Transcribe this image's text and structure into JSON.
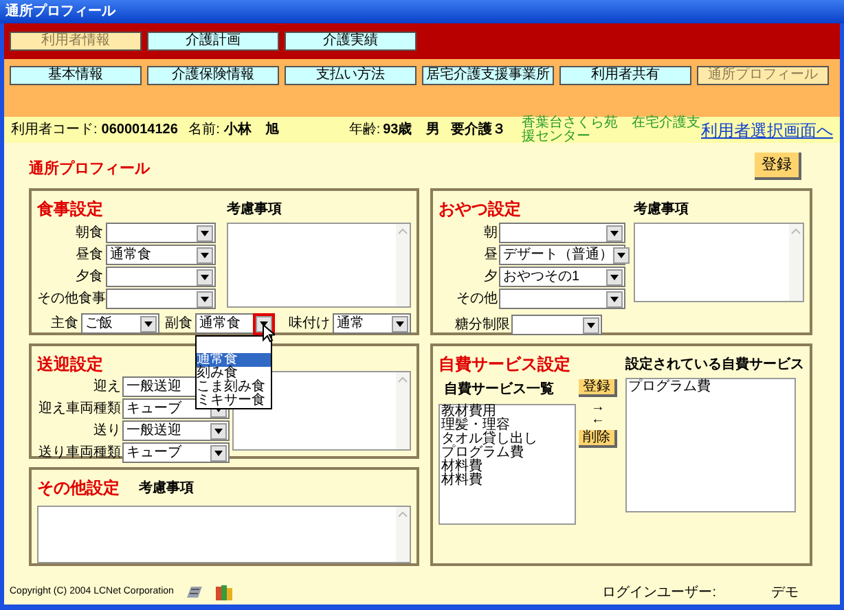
{
  "window": {
    "title": "通所プロフィール"
  },
  "main_tabs": [
    {
      "label": "利用者情報",
      "selected": true
    },
    {
      "label": "介護計画",
      "selected": false
    },
    {
      "label": "介護実績",
      "selected": false
    }
  ],
  "sub_tabs": [
    {
      "label": "基本情報",
      "selected": false
    },
    {
      "label": "介護保険情報",
      "selected": false
    },
    {
      "label": "支払い方法",
      "selected": false
    },
    {
      "label": "居宅介護支援事業所",
      "selected": false
    },
    {
      "label": "利用者共有",
      "selected": false
    },
    {
      "label": "通所プロフィール",
      "selected": true
    }
  ],
  "user_info": {
    "code_label": "利用者コード:",
    "code": "0600014126",
    "name_label": "名前:",
    "name": "小林　旭",
    "age_label": "年齢:",
    "age": "93歳",
    "sex": "男",
    "care_level": "要介護３",
    "office": "香葉台さくら苑　在宅介護支援センター",
    "link": "利用者選択画面へ"
  },
  "page_title": "通所プロフィール",
  "save_button": "登録",
  "meal": {
    "title": "食事設定",
    "notes_label": "考慮事項",
    "fields": [
      {
        "label": "朝食"
      },
      {
        "label": "昼食",
        "value": "通常食"
      },
      {
        "label": "夕食"
      },
      {
        "label": "その他食事"
      }
    ],
    "main_dish": {
      "label": "主食",
      "value": "ご飯"
    },
    "side_dish": {
      "label": "副食",
      "value": "通常食",
      "open": true
    },
    "seasoning": {
      "label": "味付け",
      "value": "通常"
    },
    "side_dish_options": [
      {
        "kind": "text",
        "label": "通常食",
        "selected": true
      },
      {
        "kind": "text",
        "label": "刻み食",
        "selected": false
      },
      {
        "kind": "text",
        "label": "こま刻み食",
        "selected": false
      },
      {
        "kind": "text",
        "label": "ミキサー食",
        "selected": false
      }
    ]
  },
  "snack": {
    "title": "おやつ設定",
    "notes_label": "考慮事項",
    "fields": [
      {
        "label": "朝"
      },
      {
        "label": "昼",
        "value": "デザート（普通）"
      },
      {
        "label": "夕",
        "value": "おやつその1"
      },
      {
        "label": "その他"
      }
    ],
    "sugar_limit": {
      "label": "糖分制限"
    }
  },
  "transport": {
    "title": "送迎設定",
    "fields": [
      {
        "label": "迎え",
        "value": "一般送迎"
      },
      {
        "label": "迎え車両種類",
        "value": "キューブ"
      },
      {
        "label": "送り",
        "value": "一般送迎"
      },
      {
        "label": "送り車両種類",
        "value": "キューブ"
      }
    ]
  },
  "other": {
    "title": "その他設定",
    "notes_label": "考慮事項"
  },
  "self_pay": {
    "title": "自費サービス設定",
    "list_label": "自費サービス一覧",
    "items": [
      "教材費用",
      "理髪・理容",
      "タオル貸し出し",
      "プログラム費",
      "材料費",
      "材料費"
    ],
    "register_button": "登録",
    "arrows": [
      "→",
      "←"
    ],
    "delete_button": "削除",
    "selected_label": "設定されている自費サービス",
    "selected_items": [
      "プログラム費"
    ]
  },
  "footer": {
    "copyright": "Copyright (C) 2004 LCNet Corporation",
    "login_label": "ログインユーザー:",
    "login_user": "デモ"
  }
}
